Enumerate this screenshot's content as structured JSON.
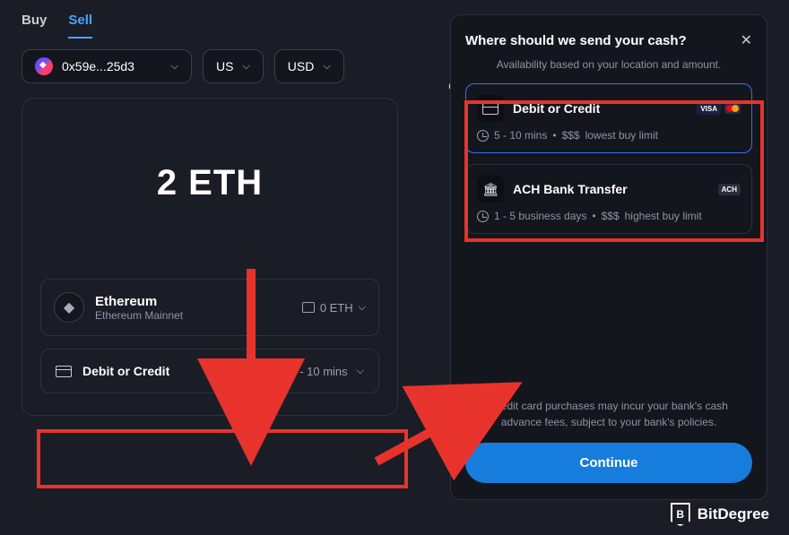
{
  "tabs": {
    "buy": "Buy",
    "sell": "Sell"
  },
  "wallet": {
    "address": "0x59e...25d3"
  },
  "country": "US",
  "currency": "USD",
  "connect_label": "Cor",
  "amount": {
    "value": "2 ETH"
  },
  "asset": {
    "name": "Ethereum",
    "network": "Ethereum Mainnet",
    "balance": "0 ETH"
  },
  "selected_method": {
    "label": "Debit or Credit",
    "time": "5 - 10 mins"
  },
  "sheet": {
    "title": "Where should we send your cash?",
    "subtitle": "Availability based on your location and amount.",
    "options": [
      {
        "title": "Debit or Credit",
        "time": "5 - 10 mins",
        "cost": "$$$",
        "limit": "lowest buy limit",
        "badge1": "VISA"
      },
      {
        "title": "ACH Bank Transfer",
        "time": "1 - 5 business days",
        "cost": "$$$",
        "limit": "highest buy limit",
        "badge1": "ACH"
      }
    ],
    "disclaimer": "Credit card purchases may incur your bank's cash advance fees, subject to your bank's policies.",
    "continue": "Continue"
  },
  "watermark": "BitDegree"
}
